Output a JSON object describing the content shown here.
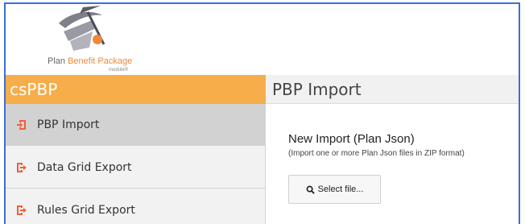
{
  "logo": {
    "plan_text": "Plan",
    "benefit_package_text": "Benefit Package",
    "module_text": "module®"
  },
  "sidebar": {
    "app_title": "csPBP",
    "items": [
      {
        "label": "PBP Import",
        "icon": "import-icon",
        "active": true
      },
      {
        "label": "Data Grid Export",
        "icon": "export-icon",
        "active": false
      },
      {
        "label": "Rules Grid Export",
        "icon": "export-icon",
        "active": false
      }
    ]
  },
  "main": {
    "page_title": "PBP Import",
    "import_title": "New Import (Plan Json)",
    "import_subtitle": "(Import one or more Plan Json files in ZIP format)",
    "select_button_label": "Select file..."
  },
  "colors": {
    "accent_orange": "#f6ad4a",
    "icon_orange": "#f0603a",
    "frame_blue": "#3a6fd8"
  }
}
